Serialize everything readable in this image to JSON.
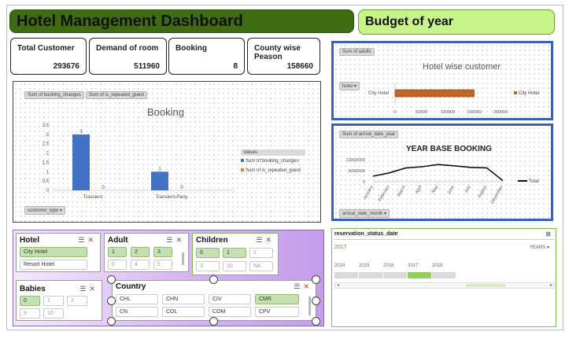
{
  "header": {
    "title": "Hotel Management Dashboard",
    "budget": "Budget of year"
  },
  "kpis": [
    {
      "label": "Total Customer",
      "value": "293676"
    },
    {
      "label": "Demand of room",
      "value": "511960"
    },
    {
      "label": "Booking",
      "value": "8"
    },
    {
      "label": "County wise Peason",
      "value": "158660"
    }
  ],
  "booking_chart": {
    "field_buttons": [
      "Sum of booking_changes",
      "Sum of is_repeated_guest"
    ],
    "title": "Booking",
    "axis_field": "customer_type",
    "legend_title": "Values",
    "y_ticks": [
      "3.5",
      "3",
      "2.5",
      "2",
      "1.5",
      "1",
      "0.5",
      "0"
    ],
    "categories": [
      "Transient",
      "Transient-Party"
    ],
    "series": [
      {
        "name": "Sum of booking_changes",
        "color": "#4472c4",
        "values": [
          3,
          1
        ]
      },
      {
        "name": "Sum of is_repeated_guest",
        "color": "#ed7d31",
        "values": [
          0,
          0
        ]
      }
    ],
    "data_labels": [
      "3",
      "0",
      "1",
      "0"
    ],
    "ylim": [
      0,
      3.5
    ]
  },
  "hotel_chart": {
    "field_button": "Sum of adults",
    "axis_button": "hotel",
    "title": "Hotel wise customer",
    "category": "City Hotel",
    "bar_color": "#c0652a",
    "x_ticks": [
      "0",
      "50000",
      "100000",
      "150000",
      "200000"
    ],
    "legend": "City Hotel",
    "value": 150000,
    "xlim": [
      0,
      200000
    ]
  },
  "year_chart": {
    "field_button": "Sum of arrival_date_year",
    "axis_button": "arrival_date_month",
    "title": "YEAR BASE BOOKING",
    "y_ticks": [
      "10000000",
      "5000000",
      "0"
    ],
    "months": [
      "January",
      "February",
      "March",
      "April",
      "May",
      "June",
      "July",
      "August",
      "December"
    ],
    "values": [
      2500000,
      4000000,
      6200000,
      6800000,
      7800000,
      7200000,
      6500000,
      6300000,
      500000
    ],
    "ylim": [
      0,
      10000000
    ],
    "legend": "Total"
  },
  "slicers": {
    "hotel": {
      "title": "Hotel",
      "items": [
        "City Hotel",
        "Resort Hotel"
      ]
    },
    "adult": {
      "title": "Adult",
      "items": [
        "1",
        "2",
        "3",
        "0",
        "4",
        "5"
      ]
    },
    "children": {
      "title": "Children",
      "items": [
        "0",
        "1",
        "2",
        "3",
        "10",
        "NA"
      ]
    },
    "babies": {
      "title": "Babies",
      "items": [
        "0",
        "1",
        "2",
        "9",
        "10"
      ]
    },
    "country": {
      "title": "Country",
      "items": [
        "CHL",
        "CHN",
        "CIV",
        "CMR",
        "CN",
        "COL",
        "COM",
        "CPV"
      ]
    }
  },
  "timeline": {
    "title": "reservation_status_date",
    "selection": "2017",
    "level": "YEARS",
    "years": [
      "2014",
      "2015",
      "2016",
      "2017",
      "2018"
    ]
  }
}
